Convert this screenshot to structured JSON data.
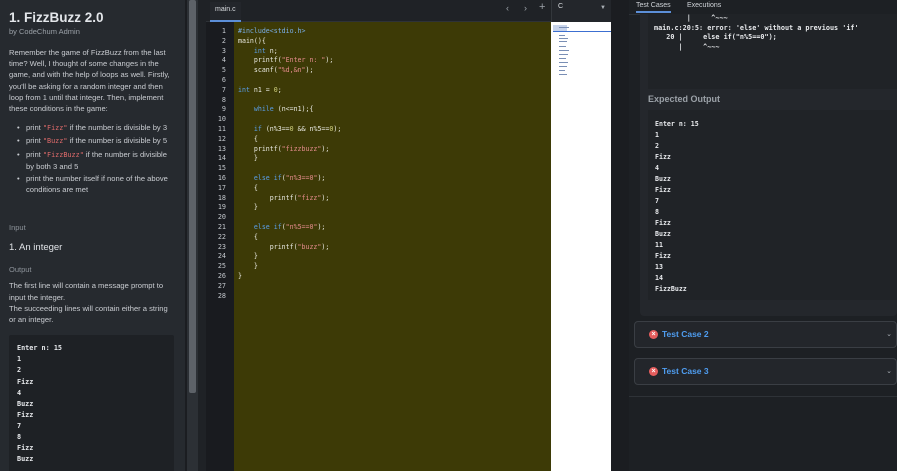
{
  "problem": {
    "title": "1. FizzBuzz 2.0",
    "author": "by CodeChum Admin",
    "description": "Remember the game of FizzBuzz from the last time? Well, I thought of some changes in the game, and with the help of loops as well. Firstly, you'll be asking for a random integer and then loop from 1 until that integer. Then, implement these conditions in the game:",
    "rules": [
      {
        "pre": "print ",
        "code": "\"Fizz\"",
        "post": " if the number is divisible by 3"
      },
      {
        "pre": "print ",
        "code": "\"Buzz\"",
        "post": " if the number is divisible by 5"
      },
      {
        "pre": "print ",
        "code": "\"FizzBuzz\"",
        "post": " if the number is divisible by both 3 and 5"
      },
      {
        "pre": "print the number itself if none of the above conditions are met",
        "code": "",
        "post": ""
      }
    ],
    "input_label": "Input",
    "input_head": "1. An integer",
    "output_label": "Output",
    "output_desc": "The first line will contain a message prompt to input the integer.",
    "output_desc2": "The succeeding lines will contain either a string or an integer.",
    "sample": [
      "Enter n: 15",
      "1",
      "2",
      "Fizz",
      "4",
      "Buzz",
      "Fizz",
      "7",
      "8",
      "Fizz",
      "Buzz"
    ]
  },
  "editor": {
    "tab": "main.c",
    "language": "C",
    "line_numbers": [
      "1",
      "2",
      "3",
      "4",
      "5",
      "6",
      "7",
      "8",
      "9",
      "10",
      "11",
      "12",
      "13",
      "14",
      "15",
      "16",
      "17",
      "18",
      "19",
      "20",
      "21",
      "22",
      "23",
      "24",
      "25",
      "26",
      "27",
      "28"
    ]
  },
  "right": {
    "tabs": [
      "Test Cases",
      "Executions"
    ],
    "error_lines": [
      "        |     ^~~~",
      "main.c:20:5: error: 'else' without a previous 'if'",
      "   20 |     else if(\"n%5==0\");",
      "      |     ^~~~"
    ],
    "expected_label": "Expected Output",
    "expected": [
      "Enter n: 15",
      "1",
      "2",
      "Fizz",
      "4",
      "Buzz",
      "Fizz",
      "7",
      "8",
      "Fizz",
      "Buzz",
      "11",
      "Fizz",
      "13",
      "14",
      "FizzBuzz"
    ],
    "test_cases": [
      "Test Case 2",
      "Test Case 3"
    ]
  }
}
